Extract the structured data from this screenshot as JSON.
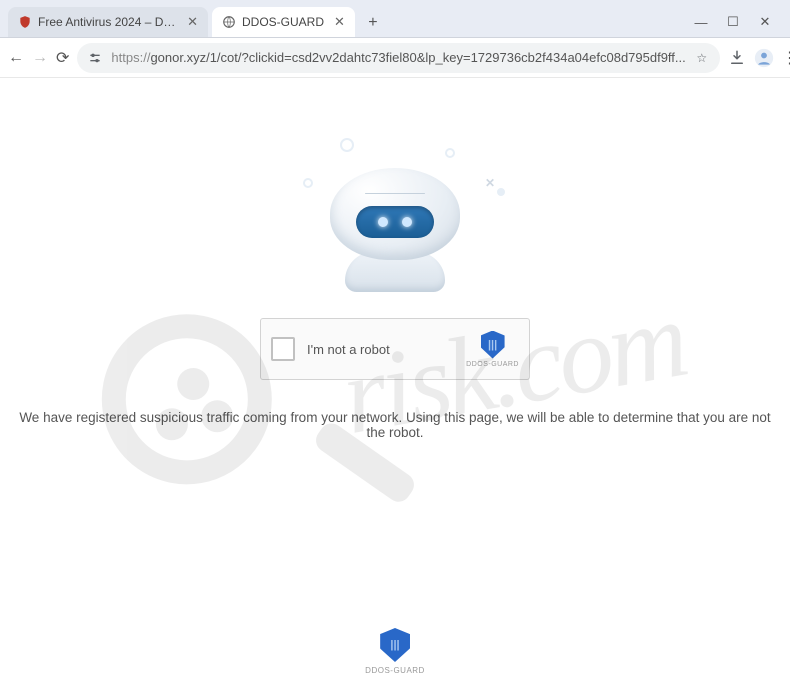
{
  "tabs": [
    {
      "title": "Free Antivirus 2024 – Downlo…"
    },
    {
      "title": "DDOS-GUARD"
    }
  ],
  "url": {
    "protocol": "https://",
    "rest": "gonor.xyz/1/cot/?clickid=csd2vv2dahtc73fiel80&lp_key=1729736cb2f434a04efc08d795df9ff..."
  },
  "captcha": {
    "label": "I'm not a robot",
    "brand": "DDOS-GUARD"
  },
  "notice": "We have registered suspicious traffic coming from your network. Using this page, we will be able to determine that you are not the robot.",
  "footer_brand": "DDOS-GUARD",
  "watermark": "risk.com"
}
